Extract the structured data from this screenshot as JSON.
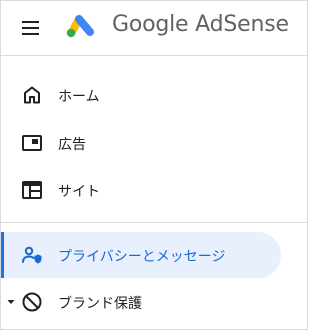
{
  "header": {
    "menu_icon": "hamburger-menu-icon",
    "logo_icon": "adsense-logo-icon",
    "logo_text": "Google AdSense",
    "colors": {
      "logo_blue": "#4285f4",
      "logo_yellow": "#fbbc04",
      "logo_green": "#34a853"
    }
  },
  "nav": {
    "items": [
      {
        "label": "ホーム",
        "icon": "home-icon"
      },
      {
        "label": "広告",
        "icon": "ads-icon"
      },
      {
        "label": "サイト",
        "icon": "sites-icon"
      },
      {
        "label": "プライバシーとメッセージ",
        "icon": "privacy-icon",
        "active": true
      },
      {
        "label": "ブランド保護",
        "icon": "block-icon",
        "expandable": true
      }
    ],
    "active_color": "#1967d2",
    "active_background": "#e8f0fe"
  }
}
